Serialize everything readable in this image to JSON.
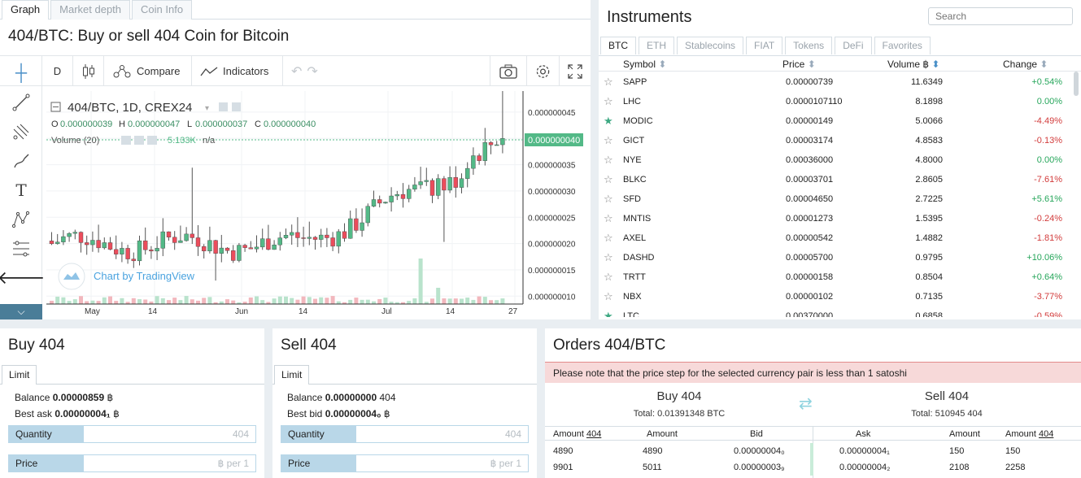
{
  "chart_tabs": [
    "Graph",
    "Market depth",
    "Coin Info"
  ],
  "pair_title": "404/BTC: Buy or sell 404 Coin for Bitcoin",
  "toolbar": {
    "interval": "D",
    "compare": "Compare",
    "indicators": "Indicators"
  },
  "chart_header": {
    "symbol": "404/BTC, 1D, CREX24",
    "o": "0.000000039",
    "h": "0.000000047",
    "l": "0.000000037",
    "c": "0.000000040",
    "volume_label": "Volume (20)",
    "volume_value": "5.133K",
    "volume_na": "n/a",
    "watermark": "Chart by TradingView",
    "last_price": "0.000000040"
  },
  "chart_data": {
    "type": "candlestick",
    "y_ticks": [
      "0.000000045",
      "0.000000040",
      "0.000000035",
      "0.000000030",
      "0.000000025",
      "0.000000020",
      "0.000000015",
      "0.000000010"
    ],
    "x_ticks": [
      "May",
      "14",
      "Jun",
      "14",
      "Jul",
      "14",
      "27"
    ],
    "ylim": [
      8.5e-09,
      4.9e-08
    ]
  },
  "colors": {
    "up": "#53b987",
    "down": "#eb4d5c",
    "accent": "#4a7d98"
  },
  "instruments": {
    "title": "Instruments",
    "search_placeholder": "Search",
    "tabs": [
      "BTC",
      "ETH",
      "Stablecoins",
      "FIAT",
      "Tokens",
      "DeFi",
      "Favorites"
    ],
    "headers": {
      "symbol": "Symbol",
      "price": "Price",
      "volume": "Volume ฿",
      "change": "Change"
    },
    "rows": [
      {
        "symbol": "SAPP",
        "price": "0.00000739",
        "volume": "11.6349",
        "change": "+0.54%",
        "dir": "up",
        "fav": false
      },
      {
        "symbol": "LHC",
        "price": "0.0000107110",
        "volume": "8.1898",
        "change": "0.00%",
        "dir": "up",
        "fav": false
      },
      {
        "symbol": "MODIC",
        "price": "0.00000149",
        "volume": "5.0066",
        "change": "-4.49%",
        "dir": "down",
        "fav": true
      },
      {
        "symbol": "GICT",
        "price": "0.00003174",
        "volume": "4.8583",
        "change": "-0.13%",
        "dir": "down",
        "fav": false
      },
      {
        "symbol": "NYE",
        "price": "0.00036000",
        "volume": "4.8000",
        "change": "0.00%",
        "dir": "up",
        "fav": false
      },
      {
        "symbol": "BLKC",
        "price": "0.00003701",
        "volume": "2.8605",
        "change": "-7.61%",
        "dir": "down",
        "fav": false
      },
      {
        "symbol": "SFD",
        "price": "0.00004650",
        "volume": "2.7225",
        "change": "+5.61%",
        "dir": "up",
        "fav": false
      },
      {
        "symbol": "MNTIS",
        "price": "0.00001273",
        "volume": "1.5395",
        "change": "-0.24%",
        "dir": "down",
        "fav": false
      },
      {
        "symbol": "AXEL",
        "price": "0.00000542",
        "volume": "1.4882",
        "change": "-1.81%",
        "dir": "down",
        "fav": false
      },
      {
        "symbol": "DASHD",
        "price": "0.00005700",
        "volume": "0.9795",
        "change": "+10.06%",
        "dir": "up",
        "fav": false
      },
      {
        "symbol": "TRTT",
        "price": "0.00000158",
        "volume": "0.8504",
        "change": "+0.64%",
        "dir": "up",
        "fav": false
      },
      {
        "symbol": "NBX",
        "price": "0.00000102",
        "volume": "0.7135",
        "change": "-3.77%",
        "dir": "down",
        "fav": false
      },
      {
        "symbol": "LTC",
        "price": "0.00370000",
        "volume": "0.6858",
        "change": "-0.59%",
        "dir": "down",
        "fav": true
      }
    ]
  },
  "buy": {
    "title": "Buy 404",
    "tab": "Limit",
    "balance_label": "Balance",
    "balance_value": "0.00000859",
    "balance_unit": "฿",
    "best_label": "Best ask",
    "best_value": "0.00000004₁",
    "best_unit": "฿",
    "quantity_label": "Quantity",
    "quantity_ph": "404",
    "price_label": "Price",
    "price_ph": "฿ per 1"
  },
  "sell": {
    "title": "Sell 404",
    "tab": "Limit",
    "balance_label": "Balance",
    "balance_value": "0.00000000",
    "balance_unit": "404",
    "best_label": "Best bid",
    "best_value": "0.00000004₀",
    "best_unit": "฿",
    "quantity_label": "Quantity",
    "quantity_ph": "404",
    "price_label": "Price",
    "price_ph": "฿ per 1"
  },
  "orders": {
    "title": "Orders 404/BTC",
    "notice": "Please note that the price step for the selected currency pair is less than 1 satoshi",
    "buy_title": "Buy 404",
    "buy_total": "Total: 0.01391348 BTC",
    "sell_title": "Sell 404",
    "sell_total": "Total: 510945 404",
    "headers": {
      "amount_a": "Amount",
      "amount_unit": "404",
      "amount_b": "Amount",
      "bid": "Bid",
      "ask": "Ask",
      "amount_c": "Amount",
      "amount_d": "Amount"
    },
    "rows": [
      {
        "buy_amt": "4890",
        "buy_amt2": "4890",
        "bid": "0.00000004₀",
        "ask": "0.00000004₁",
        "sell_amt": "150",
        "sell_amt2": "150"
      },
      {
        "buy_amt": "9901",
        "buy_amt2": "5011",
        "bid": "0.00000003₉",
        "ask": "0.00000004₂",
        "sell_amt": "2108",
        "sell_amt2": "2258"
      }
    ]
  }
}
